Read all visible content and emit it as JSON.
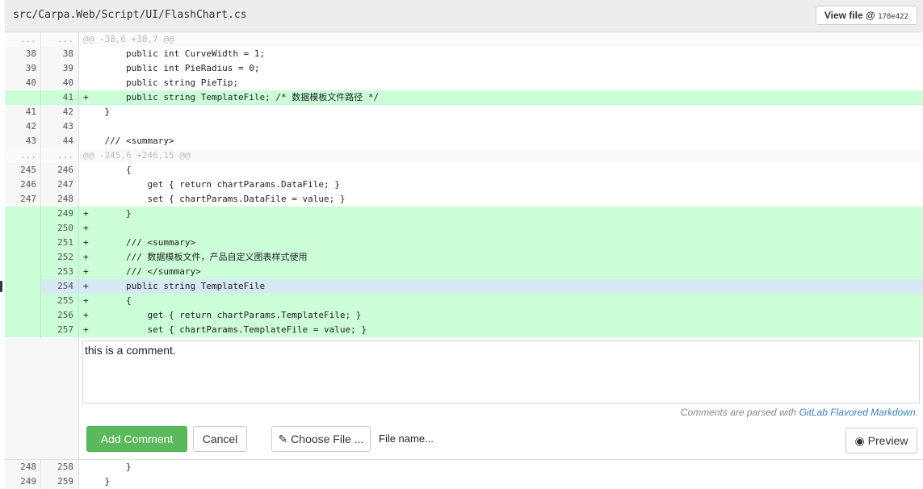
{
  "file_header": {
    "path": "src/Carpa.Web/Script/UI/FlashChart.cs",
    "view_file_label": "View file @",
    "commit_sha": "170e422"
  },
  "diff_rows_top": [
    {
      "type": "match",
      "old": "...",
      "new": "...",
      "code": "@@ -38,6 +38,7 @@"
    },
    {
      "type": "ctx",
      "old": "38",
      "new": "38",
      "code": "        public int CurveWidth = 1;"
    },
    {
      "type": "ctx",
      "old": "39",
      "new": "39",
      "code": "        public int PieRadius = 0;"
    },
    {
      "type": "ctx",
      "old": "40",
      "new": "40",
      "code": "        public string PieTip;"
    },
    {
      "type": "add",
      "old": "",
      "new": "41",
      "code": "+       public string TemplateFile; /* 数据模板文件路径 */"
    },
    {
      "type": "ctx",
      "old": "41",
      "new": "42",
      "code": "    }"
    },
    {
      "type": "ctx",
      "old": "42",
      "new": "43",
      "code": ""
    },
    {
      "type": "ctx",
      "old": "43",
      "new": "44",
      "code": "    /// <summary>"
    },
    {
      "type": "match",
      "old": "...",
      "new": "...",
      "code": "@@ -245,6 +246,15 @@"
    },
    {
      "type": "ctx",
      "old": "245",
      "new": "246",
      "code": "        {"
    },
    {
      "type": "ctx",
      "old": "246",
      "new": "247",
      "code": "            get { return chartParams.DataFile; }"
    },
    {
      "type": "ctx",
      "old": "247",
      "new": "248",
      "code": "            set { chartParams.DataFile = value; }"
    },
    {
      "type": "add",
      "old": "",
      "new": "249",
      "code": "+       }"
    },
    {
      "type": "add",
      "old": "",
      "new": "250",
      "code": "+"
    },
    {
      "type": "add",
      "old": "",
      "new": "251",
      "code": "+       /// <summary>"
    },
    {
      "type": "add",
      "old": "",
      "new": "252",
      "code": "+       /// 数据模板文件，产品自定义图表样式使用"
    },
    {
      "type": "add",
      "old": "",
      "new": "253",
      "code": "+       /// </summary>"
    },
    {
      "type": "add hl",
      "old": "",
      "new": "254",
      "code": "+       public string TemplateFile"
    },
    {
      "type": "add",
      "old": "",
      "new": "255",
      "code": "+       {"
    },
    {
      "type": "add",
      "old": "",
      "new": "256",
      "code": "+           get { return chartParams.TemplateFile; }"
    },
    {
      "type": "add",
      "old": "",
      "new": "257",
      "code": "+           set { chartParams.TemplateFile = value; }"
    }
  ],
  "comment_form": {
    "text": "this is a comment.",
    "markdown_hint_prefix": "Comments are parsed with ",
    "markdown_link": "GitLab Flavored Markdown",
    "markdown_hint_suffix": ".",
    "add_comment_label": "Add Comment",
    "cancel_label": "Cancel",
    "choose_file_label": "✎ Choose File ...",
    "file_name_label": "File name...",
    "preview_label": "◉ Preview"
  },
  "diff_rows_bottom": [
    {
      "type": "ctx",
      "old": "248",
      "new": "258",
      "code": "        }"
    },
    {
      "type": "ctx",
      "old": "249",
      "new": "259",
      "code": "    }"
    }
  ]
}
